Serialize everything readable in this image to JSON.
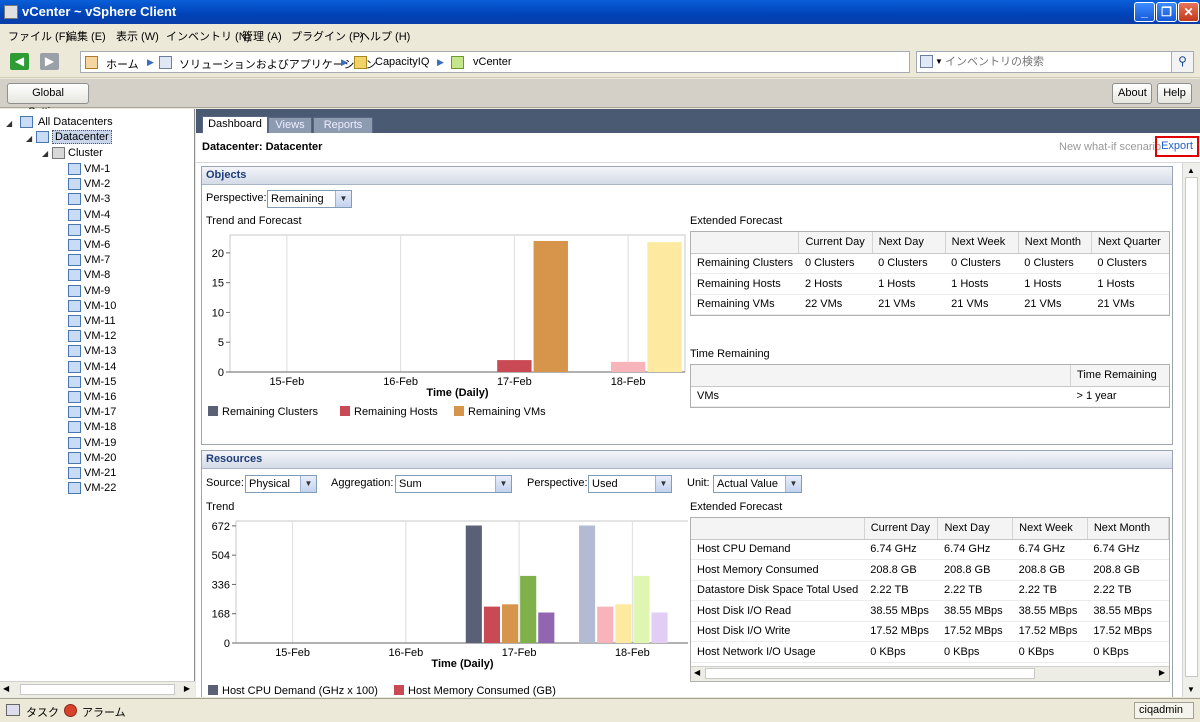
{
  "window": {
    "title": "vCenter ~ vSphere Client"
  },
  "menu": [
    "ファイル (F)",
    "編集 (E)",
    "表示 (W)",
    "インベントリ (N)",
    "管理 (A)",
    "プラグイン (P)",
    "ヘルプ (H)"
  ],
  "breadcrumbs": [
    "ホーム",
    "ソリューションおよびアプリケーション",
    "CapacityIQ",
    "vCenter"
  ],
  "search": {
    "placeholder": "インベントリの検索"
  },
  "toolbar": {
    "global_settings": "Global Settings",
    "about": "About",
    "help": "Help"
  },
  "tree": {
    "root": "All Datacenters",
    "datacenter": "Datacenter",
    "cluster": "Cluster",
    "vms": [
      "VM-1",
      "VM-2",
      "VM-3",
      "VM-4",
      "VM-5",
      "VM-6",
      "VM-7",
      "VM-8",
      "VM-9",
      "VM-10",
      "VM-11",
      "VM-12",
      "VM-13",
      "VM-14",
      "VM-15",
      "VM-16",
      "VM-17",
      "VM-18",
      "VM-19",
      "VM-20",
      "VM-21",
      "VM-22"
    ]
  },
  "tabs": [
    "Dashboard",
    "Views",
    "Reports"
  ],
  "header": {
    "title": "Datacenter: Datacenter",
    "whatif": "New what-if scenario",
    "export": "Export"
  },
  "objects": {
    "title": "Objects",
    "perspective_label": "Perspective:",
    "perspective_value": "Remaining",
    "trend_title": "Trend and Forecast",
    "ext_title": "Extended Forecast",
    "ext_columns": [
      "",
      "Current Day",
      "Next Day",
      "Next Week",
      "Next Month",
      "Next Quarter"
    ],
    "ext_rows": [
      [
        "Remaining Clusters",
        "0 Clusters",
        "0 Clusters",
        "0 Clusters",
        "0 Clusters",
        "0 Clusters"
      ],
      [
        "Remaining Hosts",
        "2 Hosts",
        "1 Hosts",
        "1 Hosts",
        "1 Hosts",
        "1 Hosts"
      ],
      [
        "Remaining VMs",
        "22 VMs",
        "21 VMs",
        "21 VMs",
        "21 VMs",
        "21 VMs"
      ]
    ],
    "time_title": "Time Remaining",
    "time_columns": [
      "",
      "Time Remaining"
    ],
    "time_rows": [
      [
        "VMs",
        "> 1 year"
      ]
    ]
  },
  "resources": {
    "title": "Resources",
    "source_label": "Source:",
    "source_value": "Physical",
    "aggregation_label": "Aggregation:",
    "aggregation_value": "Sum",
    "perspective_label": "Perspective:",
    "perspective_value": "Used",
    "unit_label": "Unit:",
    "unit_value": "Actual Value",
    "trend_title": "Trend",
    "ext_title": "Extended Forecast",
    "ext_columns": [
      "",
      "Current Day",
      "Next Day",
      "Next Week",
      "Next Month"
    ],
    "ext_rows": [
      [
        "Host CPU Demand",
        "6.74 GHz",
        "6.74 GHz",
        "6.74 GHz",
        "6.74 GHz"
      ],
      [
        "Host Memory Consumed",
        "208.8 GB",
        "208.8 GB",
        "208.8 GB",
        "208.8 GB"
      ],
      [
        "Datastore Disk Space Total Used",
        "2.22 TB",
        "2.22 TB",
        "2.22 TB",
        "2.22 TB"
      ],
      [
        "Host Disk I/O Read",
        "38.55 MBps",
        "38.55 MBps",
        "38.55 MBps",
        "38.55 MBps"
      ],
      [
        "Host Disk I/O Write",
        "17.52 MBps",
        "17.52 MBps",
        "17.52 MBps",
        "17.52 MBps"
      ],
      [
        "Host Network I/O Usage",
        "0 KBps",
        "0 KBps",
        "0 KBps",
        "0 KBps"
      ]
    ]
  },
  "status": {
    "tasks": "タスク",
    "alarms": "アラーム",
    "user": "ciqadmin"
  },
  "chart_data": [
    {
      "type": "bar",
      "title": "",
      "xlabel": "Time (Daily)",
      "ylabel": "",
      "ylim": [
        0,
        23
      ],
      "yticks": [
        0,
        5,
        10,
        15,
        20
      ],
      "categories": [
        "15-Feb",
        "16-Feb",
        "17-Feb",
        "18-Feb"
      ],
      "series": [
        {
          "name": "Remaining Clusters",
          "color": "#5a6075",
          "values": [
            0,
            0,
            0,
            0
          ],
          "forecast_color": "#b3bbd3"
        },
        {
          "name": "Remaining Hosts",
          "color": "#c94a54",
          "values": [
            0,
            0,
            2,
            1.7
          ],
          "forecast_color": "#f7b5bb"
        },
        {
          "name": "Remaining VMs",
          "color": "#d7954b",
          "values": [
            0,
            0,
            22,
            21.8
          ],
          "forecast_color": "#fdeaa0"
        }
      ],
      "forecast_categories": [
        "18-Feb"
      ]
    },
    {
      "type": "bar",
      "title": "",
      "xlabel": "Time (Daily)",
      "ylabel": "",
      "ylim": [
        0,
        700
      ],
      "yticks": [
        0,
        168,
        336,
        504,
        672
      ],
      "categories": [
        "15-Feb",
        "16-Feb",
        "17-Feb",
        "18-Feb"
      ],
      "series": [
        {
          "name": "Host CPU Demand (GHz x 100)",
          "color": "#5a6075",
          "values": [
            0,
            0,
            674,
            674
          ],
          "forecast_color": "#b3bbd3"
        },
        {
          "name": "Host Memory Consumed (GB)",
          "color": "#c94a54",
          "values": [
            0,
            0,
            208.8,
            208.8
          ],
          "forecast_color": "#f7b5bb"
        },
        {
          "name": "",
          "color": "#d7954b",
          "values": [
            0,
            0,
            222,
            222
          ],
          "forecast_color": "#fdeaa0"
        },
        {
          "name": "",
          "color": "#7fb04a",
          "values": [
            0,
            0,
            385,
            385
          ],
          "forecast_color": "#def6b1"
        },
        {
          "name": "",
          "color": "#9165b0",
          "values": [
            0,
            0,
            175,
            175
          ],
          "forecast_color": "#e2cdf5"
        },
        {
          "name": "",
          "color": "#4a8fb0",
          "values": [
            0,
            0,
            0,
            0
          ],
          "forecast_color": "#bde2f2"
        }
      ],
      "forecast_categories": [
        "18-Feb"
      ]
    }
  ]
}
